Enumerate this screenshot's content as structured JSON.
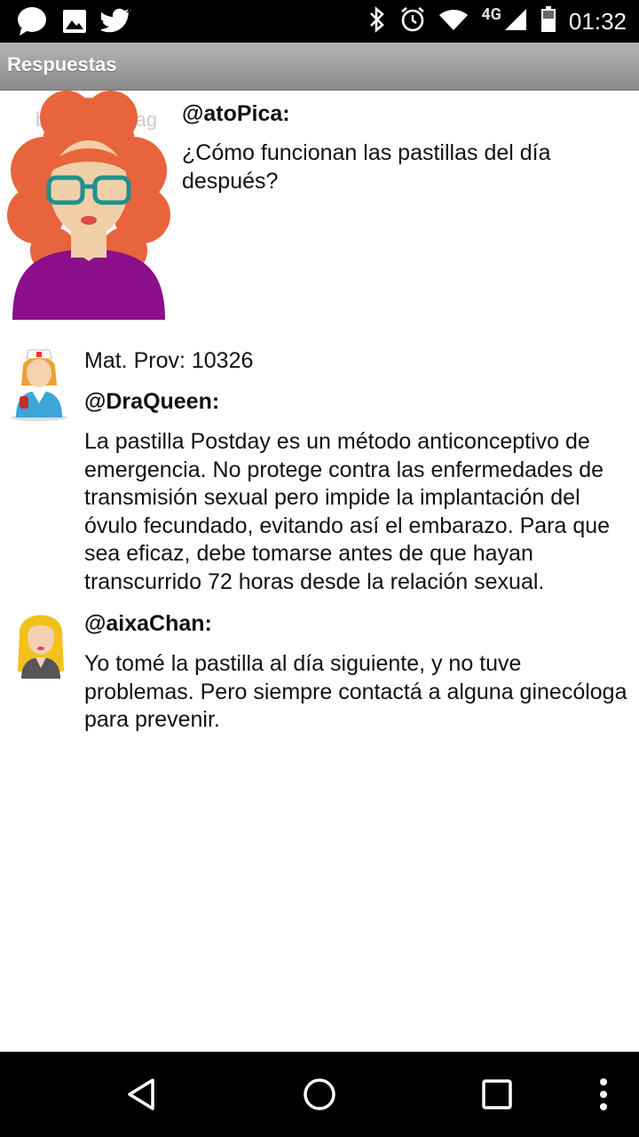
{
  "status_bar": {
    "time": "01:32",
    "network": "4G",
    "icons": [
      "chat-bubble-icon",
      "image-icon",
      "twitter-icon",
      "bluetooth-icon",
      "alarm-icon",
      "wifi-icon",
      "signal-icon",
      "battery-icon"
    ]
  },
  "title_bar": {
    "title": "Respuestas"
  },
  "posts": [
    {
      "author": "@atoPica:",
      "text": "¿Cómo funcionan las pastillas del día después?",
      "watermark": "by Getty Imag"
    },
    {
      "meta": "Mat. Prov: 10326",
      "author": "@DraQueen:",
      "text": "La pastilla Postday es un método anticonceptivo de emergencia. No protege contra las enfermedades de transmisión sexual pero impide la implantación del óvulo fecundado, evitando así el embarazo. Para que sea eficaz, debe tomarse antes de que hayan transcurrido 72 horas desde la relación sexual."
    },
    {
      "author": "@aixaChan:",
      "text": "Yo tomé la pastilla al día siguiente, y no tuve problemas. Pero siempre contactá a alguna ginecóloga para prevenir."
    }
  ],
  "nav_bar": {
    "buttons": [
      "back-icon",
      "home-icon",
      "recents-icon",
      "more-options-icon"
    ]
  },
  "colors": {
    "title_bar": "#9e9e9e",
    "hair_red": "#e8643c",
    "shirt_purple": "#8b0f8b",
    "hair_blonde": "#f2c21b"
  }
}
